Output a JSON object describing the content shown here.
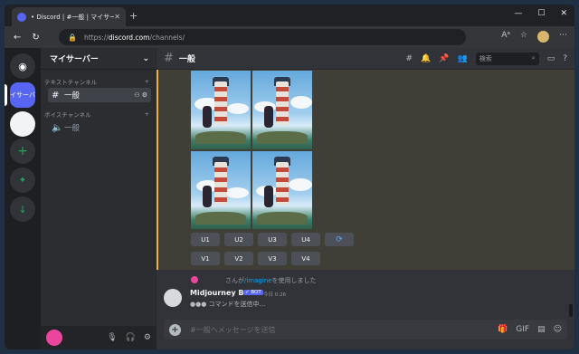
{
  "browser": {
    "tab_title": "• Discord | #一般 | マイサーバー",
    "tab_close": "✕",
    "new_tab": "+",
    "win_min": "—",
    "win_max": "☐",
    "win_close": "✕",
    "back": "←",
    "refresh": "↻",
    "lock": "🔒",
    "url_prefix": "https://",
    "url_domain": "discord.com",
    "url_suffix": "/channels/",
    "read_aloud": "Aᵃ",
    "favorite": "☆",
    "more": "⋯"
  },
  "servers": {
    "home_label": "◉",
    "active_label": "イサーバ",
    "add": "+",
    "explore": "✦",
    "download": "↓"
  },
  "sidebar": {
    "server_name": "マイサーバー",
    "chevron": "⌄",
    "text_category": "テキストチャンネル",
    "voice_category": "ボイスチャンネル",
    "text_channel": "一般",
    "voice_channel": "一般",
    "add_channel": "+",
    "channel_tools": "⚇ ⚙"
  },
  "userbar": {
    "mute": "🎙",
    "deafen": "🎧",
    "settings": "⚙"
  },
  "header": {
    "channel_name": "一般",
    "search_placeholder": "検索",
    "threads": "#",
    "bell": "🔔",
    "pin": "📌",
    "members": "👥",
    "inbox": "▭",
    "help": "?"
  },
  "buttons": {
    "upscale": [
      "U1",
      "U2",
      "U3",
      "U4"
    ],
    "variation": [
      "V1",
      "V2",
      "V3",
      "V4"
    ],
    "reroll": "⟳"
  },
  "system_message": {
    "before": "さんが",
    "link": "/imagine",
    "after": "を使用しました"
  },
  "bot_message": {
    "name": "Midjourney Bot",
    "tag": "✓ BOT",
    "timestamp": "今日 0:26",
    "body": "●●● コマンドを送信中..."
  },
  "composer": {
    "placeholder": "#一般へメッセージを送信",
    "plus": "+",
    "gift": "🎁",
    "gif": "GIF",
    "sticker": "▤",
    "emoji": "☺"
  },
  "colors": {
    "blurple": "#5865f2",
    "mention_highlight": "#f0b232",
    "link": "#00a8fc"
  }
}
